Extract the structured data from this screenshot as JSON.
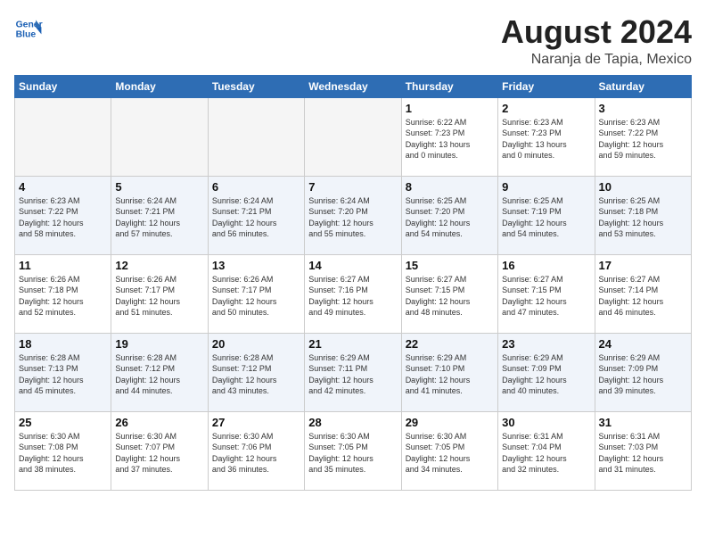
{
  "header": {
    "logo_line1": "General",
    "logo_line2": "Blue",
    "month_year": "August 2024",
    "location": "Naranja de Tapia, Mexico"
  },
  "days_of_week": [
    "Sunday",
    "Monday",
    "Tuesday",
    "Wednesday",
    "Thursday",
    "Friday",
    "Saturday"
  ],
  "weeks": [
    [
      {
        "day": "",
        "info": ""
      },
      {
        "day": "",
        "info": ""
      },
      {
        "day": "",
        "info": ""
      },
      {
        "day": "",
        "info": ""
      },
      {
        "day": "1",
        "info": "Sunrise: 6:22 AM\nSunset: 7:23 PM\nDaylight: 13 hours\nand 0 minutes."
      },
      {
        "day": "2",
        "info": "Sunrise: 6:23 AM\nSunset: 7:23 PM\nDaylight: 13 hours\nand 0 minutes."
      },
      {
        "day": "3",
        "info": "Sunrise: 6:23 AM\nSunset: 7:22 PM\nDaylight: 12 hours\nand 59 minutes."
      }
    ],
    [
      {
        "day": "4",
        "info": "Sunrise: 6:23 AM\nSunset: 7:22 PM\nDaylight: 12 hours\nand 58 minutes."
      },
      {
        "day": "5",
        "info": "Sunrise: 6:24 AM\nSunset: 7:21 PM\nDaylight: 12 hours\nand 57 minutes."
      },
      {
        "day": "6",
        "info": "Sunrise: 6:24 AM\nSunset: 7:21 PM\nDaylight: 12 hours\nand 56 minutes."
      },
      {
        "day": "7",
        "info": "Sunrise: 6:24 AM\nSunset: 7:20 PM\nDaylight: 12 hours\nand 55 minutes."
      },
      {
        "day": "8",
        "info": "Sunrise: 6:25 AM\nSunset: 7:20 PM\nDaylight: 12 hours\nand 54 minutes."
      },
      {
        "day": "9",
        "info": "Sunrise: 6:25 AM\nSunset: 7:19 PM\nDaylight: 12 hours\nand 54 minutes."
      },
      {
        "day": "10",
        "info": "Sunrise: 6:25 AM\nSunset: 7:18 PM\nDaylight: 12 hours\nand 53 minutes."
      }
    ],
    [
      {
        "day": "11",
        "info": "Sunrise: 6:26 AM\nSunset: 7:18 PM\nDaylight: 12 hours\nand 52 minutes."
      },
      {
        "day": "12",
        "info": "Sunrise: 6:26 AM\nSunset: 7:17 PM\nDaylight: 12 hours\nand 51 minutes."
      },
      {
        "day": "13",
        "info": "Sunrise: 6:26 AM\nSunset: 7:17 PM\nDaylight: 12 hours\nand 50 minutes."
      },
      {
        "day": "14",
        "info": "Sunrise: 6:27 AM\nSunset: 7:16 PM\nDaylight: 12 hours\nand 49 minutes."
      },
      {
        "day": "15",
        "info": "Sunrise: 6:27 AM\nSunset: 7:15 PM\nDaylight: 12 hours\nand 48 minutes."
      },
      {
        "day": "16",
        "info": "Sunrise: 6:27 AM\nSunset: 7:15 PM\nDaylight: 12 hours\nand 47 minutes."
      },
      {
        "day": "17",
        "info": "Sunrise: 6:27 AM\nSunset: 7:14 PM\nDaylight: 12 hours\nand 46 minutes."
      }
    ],
    [
      {
        "day": "18",
        "info": "Sunrise: 6:28 AM\nSunset: 7:13 PM\nDaylight: 12 hours\nand 45 minutes."
      },
      {
        "day": "19",
        "info": "Sunrise: 6:28 AM\nSunset: 7:12 PM\nDaylight: 12 hours\nand 44 minutes."
      },
      {
        "day": "20",
        "info": "Sunrise: 6:28 AM\nSunset: 7:12 PM\nDaylight: 12 hours\nand 43 minutes."
      },
      {
        "day": "21",
        "info": "Sunrise: 6:29 AM\nSunset: 7:11 PM\nDaylight: 12 hours\nand 42 minutes."
      },
      {
        "day": "22",
        "info": "Sunrise: 6:29 AM\nSunset: 7:10 PM\nDaylight: 12 hours\nand 41 minutes."
      },
      {
        "day": "23",
        "info": "Sunrise: 6:29 AM\nSunset: 7:09 PM\nDaylight: 12 hours\nand 40 minutes."
      },
      {
        "day": "24",
        "info": "Sunrise: 6:29 AM\nSunset: 7:09 PM\nDaylight: 12 hours\nand 39 minutes."
      }
    ],
    [
      {
        "day": "25",
        "info": "Sunrise: 6:30 AM\nSunset: 7:08 PM\nDaylight: 12 hours\nand 38 minutes."
      },
      {
        "day": "26",
        "info": "Sunrise: 6:30 AM\nSunset: 7:07 PM\nDaylight: 12 hours\nand 37 minutes."
      },
      {
        "day": "27",
        "info": "Sunrise: 6:30 AM\nSunset: 7:06 PM\nDaylight: 12 hours\nand 36 minutes."
      },
      {
        "day": "28",
        "info": "Sunrise: 6:30 AM\nSunset: 7:05 PM\nDaylight: 12 hours\nand 35 minutes."
      },
      {
        "day": "29",
        "info": "Sunrise: 6:30 AM\nSunset: 7:05 PM\nDaylight: 12 hours\nand 34 minutes."
      },
      {
        "day": "30",
        "info": "Sunrise: 6:31 AM\nSunset: 7:04 PM\nDaylight: 12 hours\nand 32 minutes."
      },
      {
        "day": "31",
        "info": "Sunrise: 6:31 AM\nSunset: 7:03 PM\nDaylight: 12 hours\nand 31 minutes."
      }
    ]
  ]
}
